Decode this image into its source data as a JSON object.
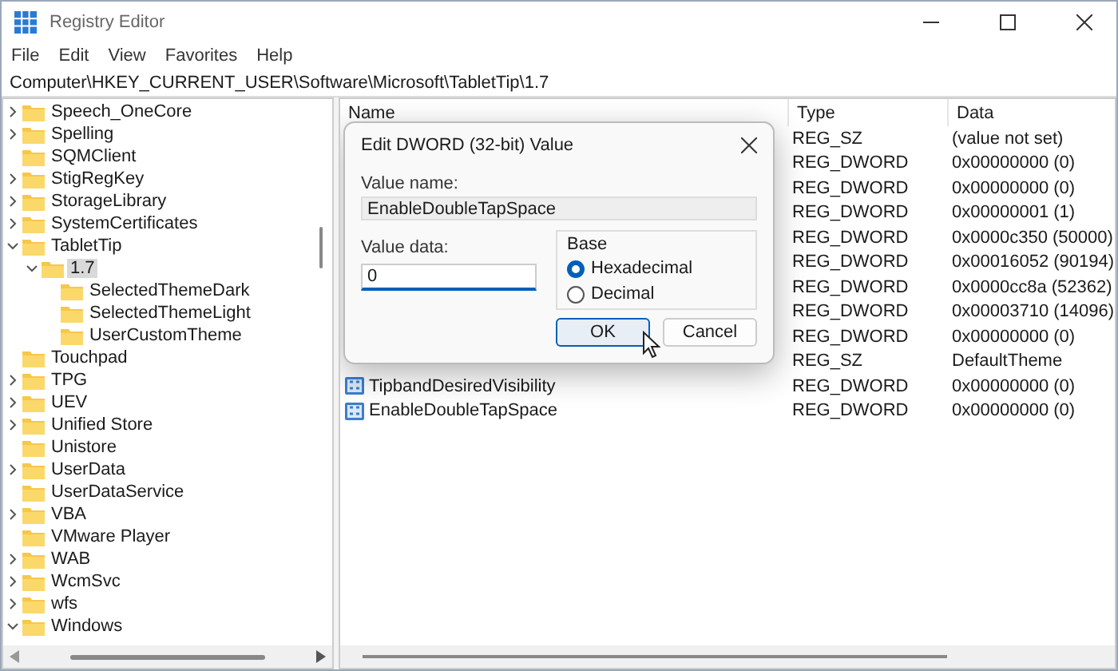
{
  "window": {
    "title": "Registry Editor"
  },
  "menu": [
    "File",
    "Edit",
    "View",
    "Favorites",
    "Help"
  ],
  "address": "Computer\\HKEY_CURRENT_USER\\Software\\Microsoft\\TabletTip\\1.7",
  "tree": [
    {
      "label": "Speech_OneCore",
      "expanded": false,
      "selected": false
    },
    {
      "label": "Spelling",
      "expanded": false,
      "selected": false
    },
    {
      "label": "SQMClient",
      "selected": false
    },
    {
      "label": "StigRegKey",
      "expanded": false,
      "selected": false
    },
    {
      "label": "StorageLibrary",
      "expanded": false,
      "selected": false
    },
    {
      "label": "SystemCertificates",
      "expanded": false,
      "selected": false
    },
    {
      "label": "TabletTip",
      "expanded": true,
      "selected": false,
      "children": [
        {
          "label": "1.7",
          "expanded": true,
          "selected": true,
          "children": [
            {
              "label": "SelectedThemeDark",
              "selected": false
            },
            {
              "label": "SelectedThemeLight",
              "selected": false
            },
            {
              "label": "UserCustomTheme",
              "selected": false
            }
          ]
        }
      ]
    },
    {
      "label": "Touchpad",
      "selected": false
    },
    {
      "label": "TPG",
      "expanded": false,
      "selected": false
    },
    {
      "label": "UEV",
      "expanded": false,
      "selected": false
    },
    {
      "label": "Unified Store",
      "expanded": false,
      "selected": false
    },
    {
      "label": "Unistore",
      "selected": false
    },
    {
      "label": "UserData",
      "expanded": false,
      "selected": false
    },
    {
      "label": "UserDataService",
      "selected": false
    },
    {
      "label": "VBA",
      "expanded": false,
      "selected": false
    },
    {
      "label": "VMware Player",
      "selected": false
    },
    {
      "label": "WAB",
      "expanded": false,
      "selected": false
    },
    {
      "label": "WcmSvc",
      "expanded": false,
      "selected": false
    },
    {
      "label": "wfs",
      "expanded": false,
      "selected": false
    },
    {
      "label": "Windows",
      "expanded": true,
      "selected": false
    }
  ],
  "table": {
    "columns": [
      "Name",
      "Type",
      "Data"
    ],
    "rows": [
      {
        "type": "REG_SZ",
        "data": "(value not set)"
      },
      {
        "type": "REG_DWORD",
        "data": "0x00000000 (0)"
      },
      {
        "type": "REG_DWORD",
        "data": "0x00000000 (0)"
      },
      {
        "type": "REG_DWORD",
        "data": "0x00000001 (1)"
      },
      {
        "type": "REG_DWORD",
        "data": "0x0000c350 (50000)"
      },
      {
        "type": "REG_DWORD",
        "data": "0x00016052 (90194)"
      },
      {
        "type": "REG_DWORD",
        "data": "0x0000cc8a (52362)"
      },
      {
        "type": "REG_DWORD",
        "data": "0x00003710 (14096)"
      },
      {
        "type": "REG_DWORD",
        "data": "0x00000000 (0)"
      },
      {
        "type": "REG_SZ",
        "data": "DefaultTheme"
      },
      {
        "name": "TipbandDesiredVisibility",
        "type": "REG_DWORD",
        "data": "0x00000000 (0)"
      },
      {
        "name": "EnableDoubleTapSpace",
        "type": "REG_DWORD",
        "data": "0x00000000 (0)"
      }
    ]
  },
  "dialog": {
    "title": "Edit DWORD (32-bit) Value",
    "value_name_label": "Value name:",
    "value_name": "EnableDoubleTapSpace",
    "value_data_label": "Value data:",
    "value_data": "0",
    "base_label": "Base",
    "radios": [
      {
        "label": "Hexadecimal",
        "selected": true
      },
      {
        "label": "Decimal",
        "selected": false
      }
    ],
    "buttons": [
      {
        "label": "OK",
        "selected": true
      },
      {
        "label": "Cancel",
        "selected": false
      }
    ]
  }
}
